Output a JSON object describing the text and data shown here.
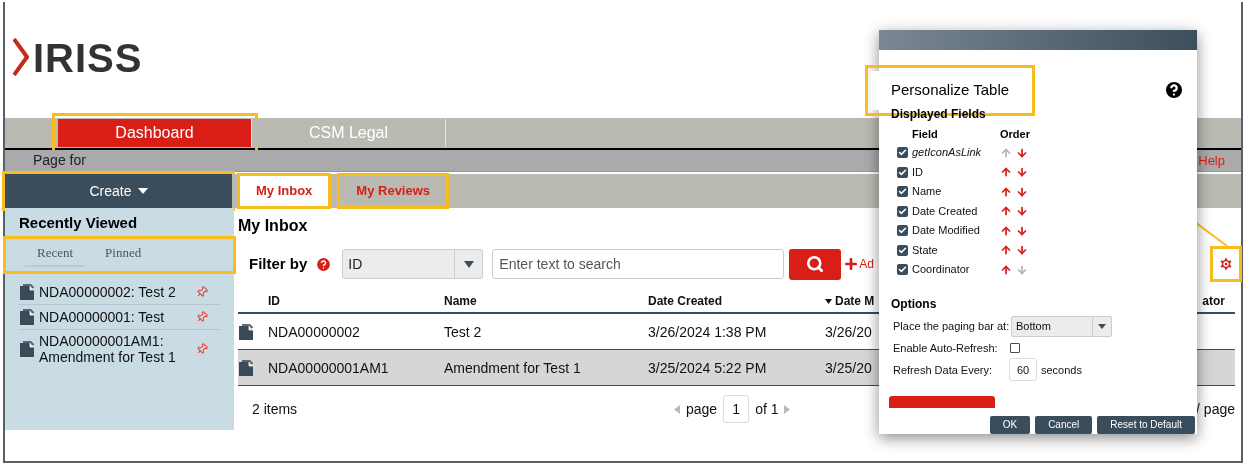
{
  "logo": {
    "text": "IRISS"
  },
  "nav": [
    {
      "label": "Dashboard",
      "selected": true,
      "highlighted": true
    },
    {
      "label": "CSM Legal",
      "selected": false,
      "highlighted": false
    }
  ],
  "page_for": {
    "label": "Page for",
    "help": "Help"
  },
  "create_button": {
    "label": "Create",
    "highlighted": true
  },
  "content_tabs": [
    {
      "label": "My Inbox",
      "selected": true,
      "highlighted": true
    },
    {
      "label": "My Reviews",
      "selected": false,
      "highlighted": true
    }
  ],
  "sidebar": {
    "title": "Recently Viewed",
    "tab_bar_highlighted": true,
    "tabs": [
      {
        "label": "Recent",
        "selected": true
      },
      {
        "label": "Pinned",
        "selected": false
      }
    ],
    "items": [
      "NDA00000002: Test 2",
      "NDA00000001: Test",
      "NDA00000001AM1: Amendment for Test 1"
    ]
  },
  "inbox": {
    "title": "My Inbox",
    "filter_label": "Filter by",
    "filter_field": "ID",
    "search_placeholder": "Enter text to search",
    "add_link": "Ad",
    "columns": [
      {
        "label": "ID",
        "sorted": false
      },
      {
        "label": "Name",
        "sorted": false
      },
      {
        "label": "Date Created",
        "sorted": false
      },
      {
        "label": "Date M",
        "sorted": true
      },
      {
        "label": "ator",
        "sorted": false
      }
    ],
    "rows": [
      {
        "selected": false,
        "cells": [
          "NDA00000002",
          "Test 2",
          "3/26/2024 1:38 PM",
          "3/26/20"
        ]
      },
      {
        "selected": true,
        "cells": [
          "NDA00000001AM1",
          "Amendment for Test 1",
          "3/25/2024 5:22 PM",
          "3/25/20"
        ]
      }
    ],
    "count": "2 items",
    "pager": {
      "label": "page",
      "page": "1",
      "of": "of 1",
      "per_page": "/ page"
    }
  },
  "dialog": {
    "title": "Personalize Table",
    "section": "Displayed Fields",
    "field_header": "Field",
    "order_header": "Order",
    "fields": [
      {
        "label": "getIconAsLink",
        "kind": "computed",
        "checked": true,
        "up_enabled": false,
        "down_enabled": true
      },
      {
        "label": "ID",
        "kind": "field",
        "checked": true,
        "up_enabled": true,
        "down_enabled": true
      },
      {
        "label": "Name",
        "kind": "field",
        "checked": true,
        "up_enabled": true,
        "down_enabled": true
      },
      {
        "label": "Date Created",
        "kind": "field",
        "checked": true,
        "up_enabled": true,
        "down_enabled": true
      },
      {
        "label": "Date Modified",
        "kind": "field",
        "checked": true,
        "up_enabled": true,
        "down_enabled": true
      },
      {
        "label": "State",
        "kind": "field",
        "checked": true,
        "up_enabled": true,
        "down_enabled": true
      },
      {
        "label": "Coordinator",
        "kind": "field",
        "checked": true,
        "up_enabled": true,
        "down_enabled": false
      }
    ],
    "options_title": "Options",
    "paging_label": "Place the paging bar at:",
    "paging_value": "Bottom",
    "auto_refresh_label": "Enable Auto-Refresh:",
    "auto_refresh": false,
    "refresh_label": "Refresh Data Every:",
    "refresh_value": "60",
    "refresh_unit": "seconds",
    "buttons": [
      "OK",
      "Cancel",
      "Reset to Default"
    ]
  }
}
